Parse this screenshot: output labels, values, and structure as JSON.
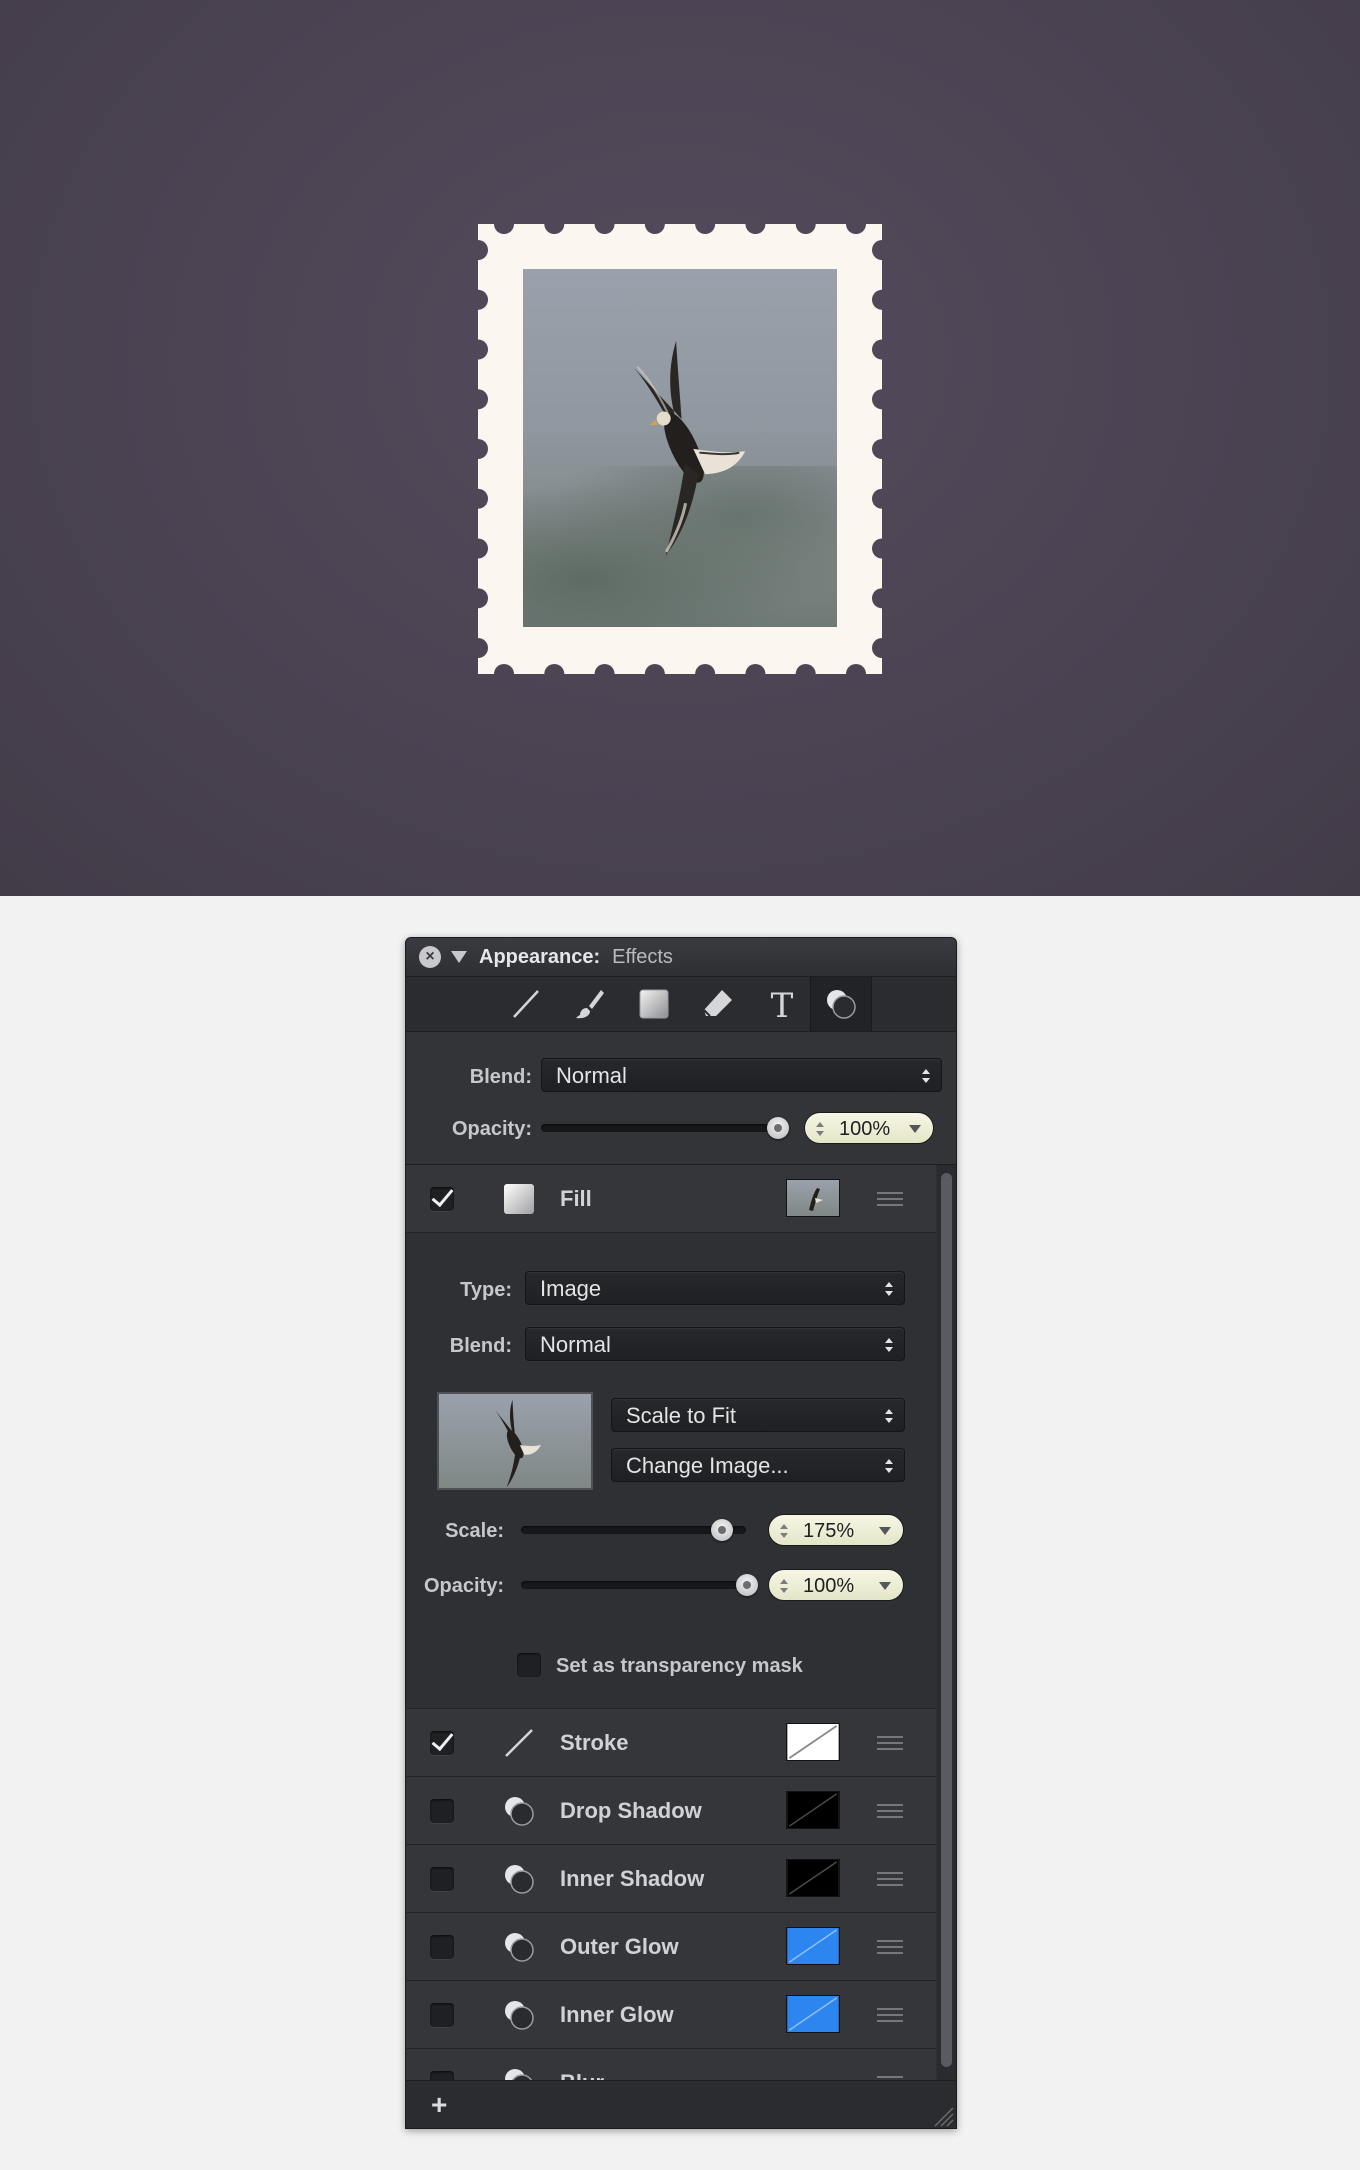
{
  "panel": {
    "title": "Appearance:",
    "subtitle": "Effects",
    "close_icon": "×",
    "tools": [
      "line-tool-icon",
      "brush-tool-icon",
      "fill-tool-icon",
      "eraser-tool-icon",
      "text-tool-icon",
      "effects-tool-icon"
    ],
    "text_tool_glyph": "T"
  },
  "blend_section": {
    "blend_label": "Blend:",
    "blend_value": "Normal",
    "opacity_label": "Opacity:",
    "opacity_value": "100%",
    "opacity_fraction": 1.0
  },
  "fill": {
    "label": "Fill",
    "checked": true,
    "type_label": "Type:",
    "type_value": "Image",
    "blend_label": "Blend:",
    "blend_value": "Normal",
    "scale_mode": "Scale to Fit",
    "change_image": "Change Image...",
    "scale_label": "Scale:",
    "scale_value": "175%",
    "scale_fraction": 0.85,
    "opacity_label": "Opacity:",
    "opacity_value": "100%",
    "opacity_fraction": 1.0,
    "mask_label": "Set as transparency mask"
  },
  "effects": [
    {
      "label": "Stroke",
      "checked": true,
      "icon": "stroke-icon",
      "swatch": "stroke"
    },
    {
      "label": "Drop Shadow",
      "checked": false,
      "icon": "effects-icon",
      "swatch": "black"
    },
    {
      "label": "Inner Shadow",
      "checked": false,
      "icon": "effects-icon",
      "swatch": "black"
    },
    {
      "label": "Outer Glow",
      "checked": false,
      "icon": "effects-icon",
      "swatch": "blue"
    },
    {
      "label": "Inner Glow",
      "checked": false,
      "icon": "effects-icon",
      "swatch": "blue"
    },
    {
      "label": "Blur",
      "checked": false,
      "icon": "effects-icon",
      "swatch": "none"
    }
  ],
  "footer": {
    "add_label": "+"
  },
  "colors": {
    "canvas": "#4b4352",
    "stamp_paper": "#fbf6ef",
    "glow_blue": "#2d86f0",
    "field_yellow": "#eef0d6"
  }
}
